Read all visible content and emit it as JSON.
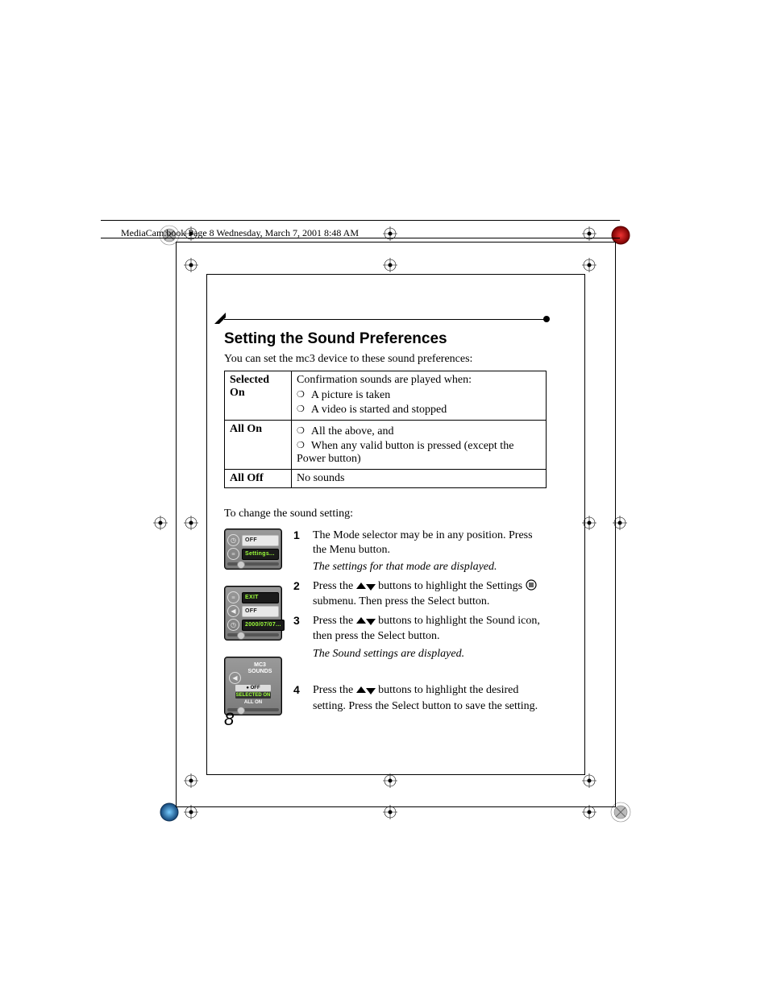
{
  "header_text": "MediaCam.book  Page 8  Wednesday, March 7, 2001  8:48 AM",
  "section_title": "Setting the Sound Preferences",
  "intro": "You can set the mc3 device to these sound preferences:",
  "table": {
    "rows": [
      {
        "label": "Selected On",
        "desc_intro": "Confirmation sounds are played when:",
        "bullets": [
          "A picture is taken",
          "A video is started and stopped"
        ]
      },
      {
        "label": "All On",
        "desc_intro": "",
        "bullets": [
          "All the above, and",
          "When any valid button is pressed (except the Power button)"
        ]
      },
      {
        "label": "All Off",
        "desc_plain": "No sounds"
      }
    ]
  },
  "change_intro": "To change the sound setting:",
  "lcd1": {
    "row1": "OFF",
    "row2": "Settings..."
  },
  "lcd2": {
    "row1": "EXIT",
    "row2": "OFF",
    "row3": "2000/07/07..."
  },
  "lcd3": {
    "title1": "MC3",
    "title2": "SOUNDS",
    "opt_off": "● OFF",
    "opt_sel": "SELECTED ON",
    "opt_all": "ALL ON"
  },
  "steps": {
    "s1": {
      "num": "1",
      "text": "The Mode selector may be in any position. Press the Menu button.",
      "italic": "The settings for that mode are displayed."
    },
    "s2": {
      "num": "2",
      "text_a": "Press the ",
      "text_b": " buttons to highlight the Settings ",
      "text_c": " submenu. Then press the Select button."
    },
    "s3": {
      "num": "3",
      "text_a": "Press the ",
      "text_b": " buttons to highlight the Sound icon, then press the Select button.",
      "italic": "The Sound settings are displayed."
    },
    "s4": {
      "num": "4",
      "text_a": "Press the ",
      "text_b": " buttons to highlight the desired setting. Press the Select button to save the setting."
    }
  },
  "page_number": "8"
}
